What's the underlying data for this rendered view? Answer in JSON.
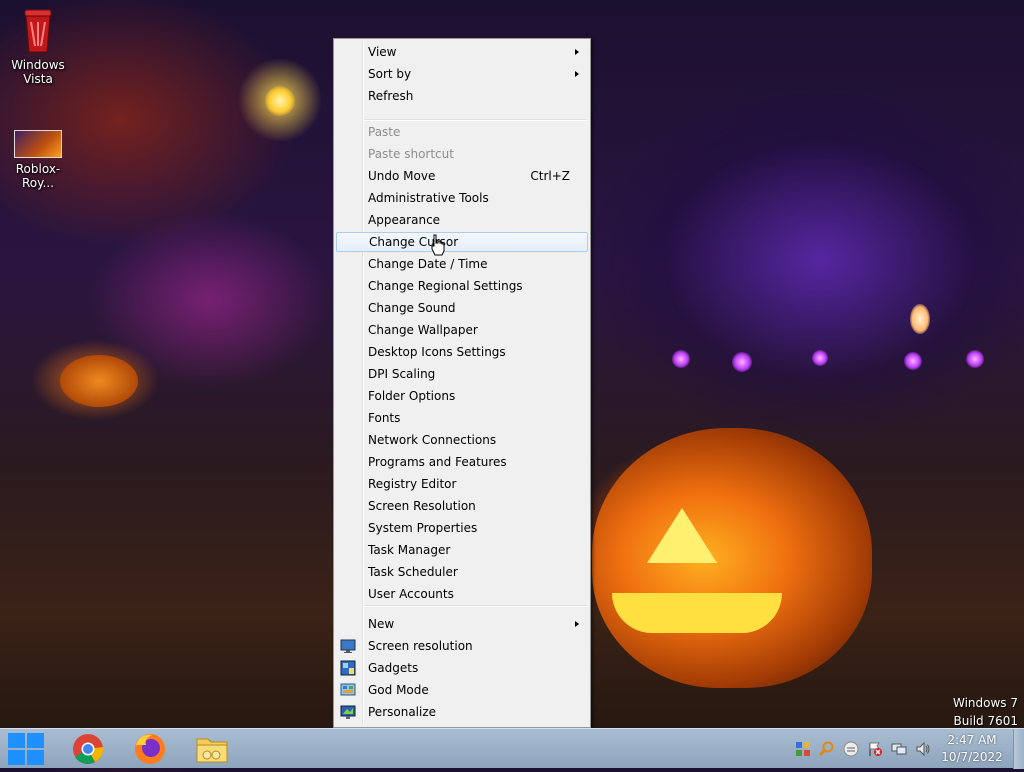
{
  "desktop": {
    "icons": [
      {
        "label_line1": "Windows",
        "label_line2": "Vista"
      },
      {
        "label_line1": "Roblox-Roy...",
        "label_line2": ""
      }
    ],
    "watermark": {
      "line1": "Windows 7",
      "line2": "Build 7601"
    }
  },
  "context_menu": {
    "items": [
      {
        "label": "View",
        "submenu": true
      },
      {
        "label": "Sort by",
        "submenu": true
      },
      {
        "label": "Refresh"
      },
      {
        "label": "Paste",
        "disabled": true
      },
      {
        "label": "Paste shortcut",
        "disabled": true
      },
      {
        "label": "Undo Move",
        "shortcut": "Ctrl+Z"
      },
      {
        "label": "Administrative Tools"
      },
      {
        "label": "Appearance"
      },
      {
        "label": "Change Cursor",
        "highlighted": true
      },
      {
        "label": "Change Date / Time"
      },
      {
        "label": "Change Regional Settings"
      },
      {
        "label": "Change Sound"
      },
      {
        "label": "Change Wallpaper"
      },
      {
        "label": "Desktop Icons Settings"
      },
      {
        "label": "DPI Scaling"
      },
      {
        "label": "Folder Options"
      },
      {
        "label": "Fonts"
      },
      {
        "label": "Network Connections"
      },
      {
        "label": "Programs and Features"
      },
      {
        "label": "Registry Editor"
      },
      {
        "label": "Screen Resolution"
      },
      {
        "label": "System Properties"
      },
      {
        "label": "Task Manager"
      },
      {
        "label": "Task Scheduler"
      },
      {
        "label": "User Accounts"
      },
      {
        "label": "New",
        "submenu": true
      },
      {
        "label": "Screen resolution",
        "icon": "display-icon"
      },
      {
        "label": "Gadgets",
        "icon": "gadgets-icon"
      },
      {
        "label": "God Mode",
        "icon": "control-panel-icon"
      },
      {
        "label": "Personalize",
        "icon": "personalize-icon"
      }
    ]
  },
  "taskbar": {
    "start_icon": "windows-logo-icon",
    "pinned_apps": [
      "chrome-icon",
      "firefox-icon",
      "file-explorer-icon"
    ],
    "tray_icons": [
      "action-center-icon",
      "search-icon",
      "messenger-icon",
      "flag-alert-icon",
      "network-icon",
      "volume-icon"
    ],
    "clock": {
      "time": "2:47 AM",
      "date": "10/7/2022"
    }
  },
  "colors": {
    "taskbar": "#9db2c8",
    "menu_bg": "#f0f0f0",
    "menu_hover_border": "#aeccef",
    "disabled_text": "#8d8d8d"
  }
}
